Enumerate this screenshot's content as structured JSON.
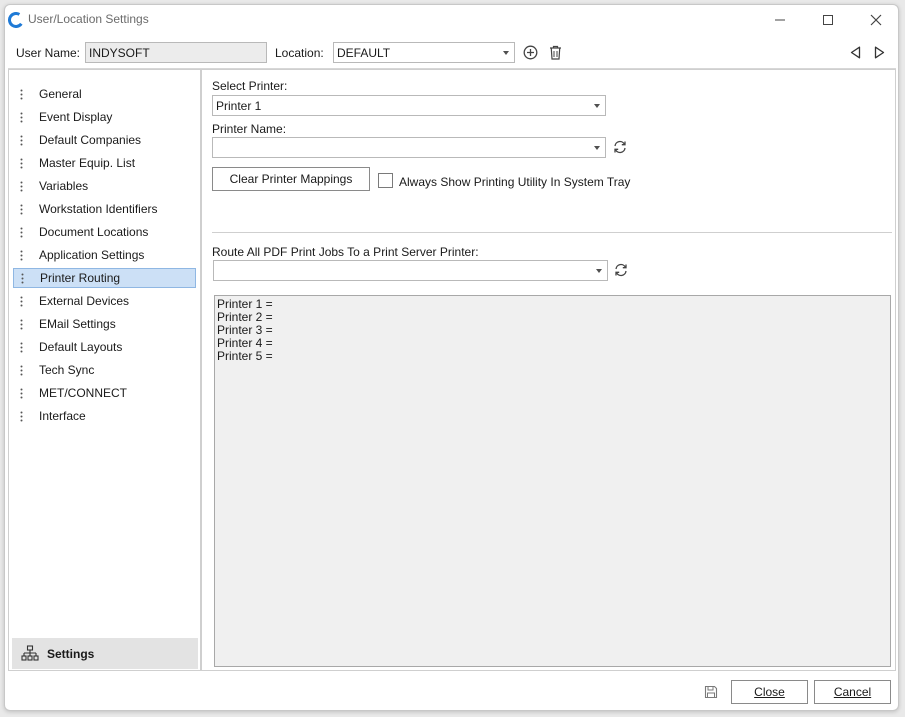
{
  "window": {
    "title": "User/Location Settings"
  },
  "topbar": {
    "user_name_label": "User Name:",
    "user_name_value": "INDYSOFT",
    "location_label": "Location:",
    "location_value": "DEFAULT"
  },
  "sidebar": {
    "items": [
      {
        "label": "General"
      },
      {
        "label": "Event Display"
      },
      {
        "label": "Default Companies"
      },
      {
        "label": "Master Equip. List"
      },
      {
        "label": "Variables"
      },
      {
        "label": "Workstation Identifiers"
      },
      {
        "label": "Document Locations"
      },
      {
        "label": "Application Settings"
      },
      {
        "label": "Printer Routing"
      },
      {
        "label": "External Devices"
      },
      {
        "label": "EMail Settings"
      },
      {
        "label": "Default Layouts"
      },
      {
        "label": "Tech Sync"
      },
      {
        "label": "MET/CONNECT"
      },
      {
        "label": "Interface"
      }
    ],
    "active_index": 8,
    "footer_label": "Settings"
  },
  "printer_routing": {
    "select_printer_label": "Select Printer:",
    "select_printer_value": "Printer 1",
    "printer_name_label": "Printer Name:",
    "printer_name_value": "",
    "clear_button": "Clear Printer Mappings",
    "always_show_label": "Always Show Printing Utility In System Tray",
    "route_pdf_label": "Route All PDF Print Jobs To a Print Server Printer:",
    "route_pdf_value": "",
    "mappings": [
      "Printer 1 =",
      "Printer 2 =",
      "Printer 3 =",
      "Printer 4 =",
      "Printer 5 ="
    ]
  },
  "footer": {
    "close_label": "Close",
    "cancel_label": "Cancel"
  },
  "icons": {
    "app": "app-logo-icon",
    "add": "add-circle-icon",
    "delete": "trash-icon",
    "prev": "triangle-left-icon",
    "next": "triangle-right-icon",
    "refresh": "refresh-icon",
    "save": "save-disk-icon",
    "settings": "hierarchy-icon"
  },
  "colors": {
    "accent": "#1f7ad6",
    "selection": "#cce0f6"
  }
}
